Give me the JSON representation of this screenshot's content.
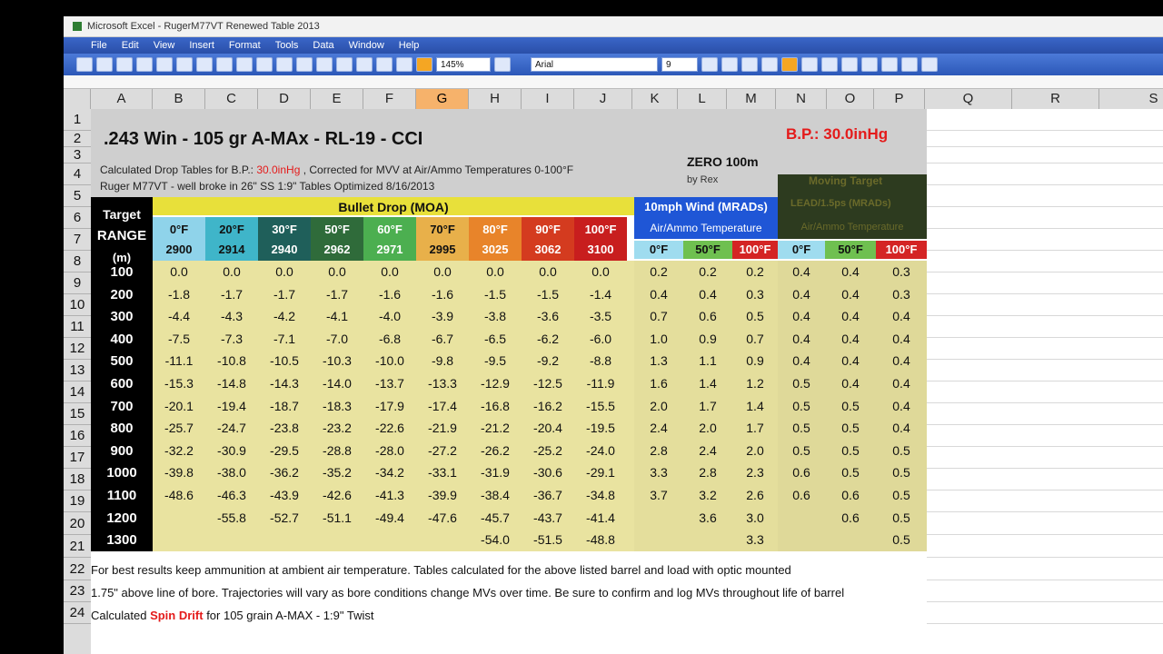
{
  "window": {
    "title": "Microsoft Excel - RugerM77VT Renewed Table 2013"
  },
  "menu": [
    "File",
    "Edit",
    "View",
    "Insert",
    "Format",
    "Tools",
    "Data",
    "Window",
    "Help"
  ],
  "toolbar": {
    "zoom": "145%",
    "font": "Arial",
    "size": "9"
  },
  "columns": [
    "A",
    "B",
    "C",
    "D",
    "E",
    "F",
    "G",
    "H",
    "I",
    "J",
    "K",
    "L",
    "M",
    "N",
    "O",
    "P",
    "Q",
    "R",
    "S"
  ],
  "selected_column": "G",
  "rows": [
    "1",
    "2",
    "3",
    "4",
    "5",
    "6",
    "7",
    "8",
    "9",
    "10",
    "11",
    "12",
    "13",
    "14",
    "15",
    "16",
    "17",
    "18",
    "19",
    "20",
    "21",
    "22",
    "23",
    "24"
  ],
  "sheet": {
    "title": ".243 Win - 105 gr A-MAx - RL-19 - CCI",
    "bp": "B.P.: 30.0inHg",
    "line2_prefix": "Calculated Drop Tables for B.P.:",
    "line2_bp": "30.0inHg",
    "line2_suffix": ", Corrected for MVV at Air/Ammo Temperatures 0-100°F",
    "line3": "Ruger M77VT - well broke in 26\" SS 1:9\" Tables Optimized 8/16/2013",
    "zero": "ZERO 100m",
    "by": "by Rex",
    "moving_target": "Moving Target",
    "lead_label": "LEAD/1.5ps (MRADs)",
    "target_label": "Target",
    "range_label": "RANGE",
    "m_label": "(m)",
    "bullet_drop": "Bullet Drop (MOA)",
    "wind_label": "10mph Wind (MRADs)",
    "air_ammo": "Air/Ammo Temperature",
    "air_ammo_lead": "Air/Ammo Temperature",
    "drop_temps": [
      {
        "t": "0°F",
        "v": "2900",
        "bg": "#8fd3ea"
      },
      {
        "t": "20°F",
        "v": "2914",
        "bg": "#3fb5c9"
      },
      {
        "t": "30°F",
        "v": "2940",
        "bg": "#1f5f5a"
      },
      {
        "t": "50°F",
        "v": "2962",
        "bg": "#2f6b3a"
      },
      {
        "t": "60°F",
        "v": "2971",
        "bg": "#4caf50"
      },
      {
        "t": "70°F",
        "v": "2995",
        "bg": "#e8b04a"
      },
      {
        "t": "80°F",
        "v": "3025",
        "bg": "#e8842a"
      },
      {
        "t": "90°F",
        "v": "3062",
        "bg": "#d43b1f"
      },
      {
        "t": "100°F",
        "v": "3100",
        "bg": "#c81e1e"
      }
    ],
    "wind_temps": [
      {
        "t": "0°F",
        "bg": "#9fdcef"
      },
      {
        "t": "50°F",
        "bg": "#6fc050"
      },
      {
        "t": "100°F",
        "bg": "#d42424"
      }
    ],
    "lead_temps": [
      {
        "t": "0°F",
        "bg": "#9fdcef"
      },
      {
        "t": "50°F",
        "bg": "#6fc050"
      },
      {
        "t": "100°F",
        "bg": "#d42424"
      }
    ],
    "ranges": [
      "100",
      "200",
      "300",
      "400",
      "500",
      "600",
      "700",
      "800",
      "900",
      "1000",
      "1100",
      "1200",
      "1300"
    ],
    "drop": [
      [
        "0.0",
        "0.0",
        "0.0",
        "0.0",
        "0.0",
        "0.0",
        "0.0",
        "0.0",
        "0.0"
      ],
      [
        "-1.8",
        "-1.7",
        "-1.7",
        "-1.7",
        "-1.6",
        "-1.6",
        "-1.5",
        "-1.5",
        "-1.4"
      ],
      [
        "-4.4",
        "-4.3",
        "-4.2",
        "-4.1",
        "-4.0",
        "-3.9",
        "-3.8",
        "-3.6",
        "-3.5"
      ],
      [
        "-7.5",
        "-7.3",
        "-7.1",
        "-7.0",
        "-6.8",
        "-6.7",
        "-6.5",
        "-6.2",
        "-6.0"
      ],
      [
        "-11.1",
        "-10.8",
        "-10.5",
        "-10.3",
        "-10.0",
        "-9.8",
        "-9.5",
        "-9.2",
        "-8.8"
      ],
      [
        "-15.3",
        "-14.8",
        "-14.3",
        "-14.0",
        "-13.7",
        "-13.3",
        "-12.9",
        "-12.5",
        "-11.9"
      ],
      [
        "-20.1",
        "-19.4",
        "-18.7",
        "-18.3",
        "-17.9",
        "-17.4",
        "-16.8",
        "-16.2",
        "-15.5"
      ],
      [
        "-25.7",
        "-24.7",
        "-23.8",
        "-23.2",
        "-22.6",
        "-21.9",
        "-21.2",
        "-20.4",
        "-19.5"
      ],
      [
        "-32.2",
        "-30.9",
        "-29.5",
        "-28.8",
        "-28.0",
        "-27.2",
        "-26.2",
        "-25.2",
        "-24.0"
      ],
      [
        "-39.8",
        "-38.0",
        "-36.2",
        "-35.2",
        "-34.2",
        "-33.1",
        "-31.9",
        "-30.6",
        "-29.1"
      ],
      [
        "-48.6",
        "-46.3",
        "-43.9",
        "-42.6",
        "-41.3",
        "-39.9",
        "-38.4",
        "-36.7",
        "-34.8"
      ],
      [
        "",
        "-55.8",
        "-52.7",
        "-51.1",
        "-49.4",
        "-47.6",
        "-45.7",
        "-43.7",
        "-41.4"
      ],
      [
        "",
        "",
        "",
        "",
        "",
        "",
        "-54.0",
        "-51.5",
        "-48.8"
      ]
    ],
    "wind": [
      [
        "0.2",
        "0.2",
        "0.2"
      ],
      [
        "0.4",
        "0.4",
        "0.3"
      ],
      [
        "0.7",
        "0.6",
        "0.5"
      ],
      [
        "1.0",
        "0.9",
        "0.7"
      ],
      [
        "1.3",
        "1.1",
        "0.9"
      ],
      [
        "1.6",
        "1.4",
        "1.2"
      ],
      [
        "2.0",
        "1.7",
        "1.4"
      ],
      [
        "2.4",
        "2.0",
        "1.7"
      ],
      [
        "2.8",
        "2.4",
        "2.0"
      ],
      [
        "3.3",
        "2.8",
        "2.3"
      ],
      [
        "3.7",
        "3.2",
        "2.6"
      ],
      [
        "",
        "3.6",
        "3.0"
      ],
      [
        "",
        "",
        "3.3"
      ]
    ],
    "lead": [
      [
        "0.4",
        "0.4",
        "0.3"
      ],
      [
        "0.4",
        "0.4",
        "0.3"
      ],
      [
        "0.4",
        "0.4",
        "0.4"
      ],
      [
        "0.4",
        "0.4",
        "0.4"
      ],
      [
        "0.4",
        "0.4",
        "0.4"
      ],
      [
        "0.5",
        "0.4",
        "0.4"
      ],
      [
        "0.5",
        "0.5",
        "0.4"
      ],
      [
        "0.5",
        "0.5",
        "0.4"
      ],
      [
        "0.5",
        "0.5",
        "0.5"
      ],
      [
        "0.6",
        "0.5",
        "0.5"
      ],
      [
        "0.6",
        "0.6",
        "0.5"
      ],
      [
        "",
        "0.6",
        "0.5"
      ],
      [
        "",
        "",
        "0.5"
      ]
    ],
    "note20": "For best results keep ammunition at ambient air temperature.  Tables calculated for the above listed barrel and load with optic mounted",
    "note21": "1.75\" above line of bore.  Trajectories will vary as bore conditions change MVs over time.  Be sure to confirm and log MVs throughout life of barrel",
    "note22_a": "Calculated",
    "note22_b": "Spin Drift",
    "note22_c": "for 105 grain A-MAX - 1:9\" Twist"
  }
}
